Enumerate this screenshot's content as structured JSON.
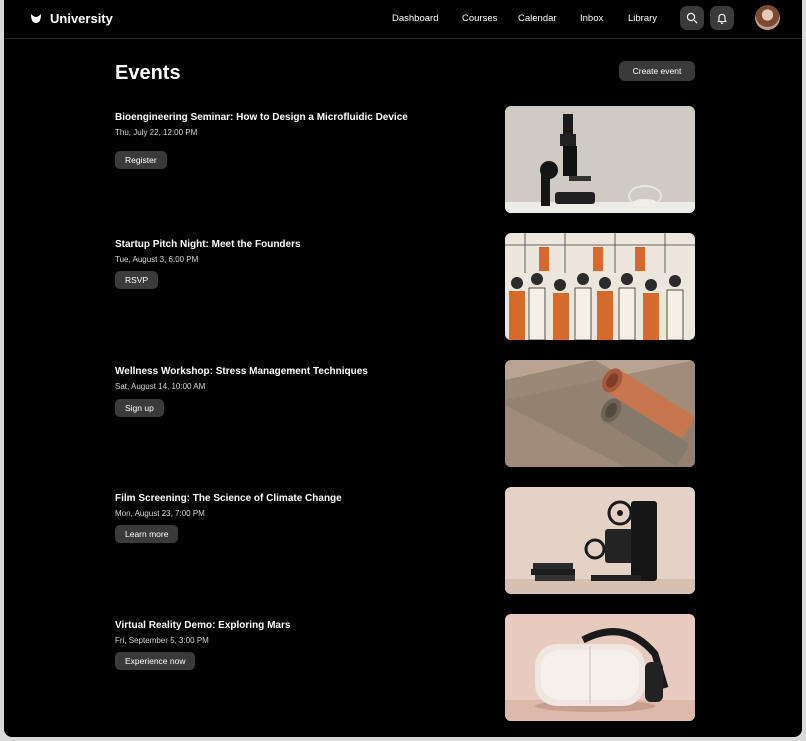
{
  "app": {
    "brand": "University"
  },
  "nav": [
    "Dashboard",
    "Courses",
    "Calendar",
    "Inbox",
    "Library"
  ],
  "page": {
    "title": "Events",
    "create_label": "Create event"
  },
  "events": [
    {
      "title": "Bioengineering Seminar: How to Design a Microfluidic Device",
      "date": "Thu, July 22, 12:00 PM",
      "action": "Register",
      "image": "microscope"
    },
    {
      "title": "Startup Pitch Night: Meet the Founders",
      "date": "Tue, August 3, 6:00 PM",
      "action": "RSVP",
      "image": "crowd-illustration"
    },
    {
      "title": "Wellness Workshop: Stress Management Techniques",
      "date": "Sat, August 14, 10:00 AM",
      "action": "Sign up",
      "image": "yoga-mats"
    },
    {
      "title": "Film Screening: The Science of Climate Change",
      "date": "Mon, August 23, 7:00 PM",
      "action": "Learn more",
      "image": "film-projector"
    },
    {
      "title": "Virtual Reality Demo: Exploring Mars",
      "date": "Fri, September 5, 3:00 PM",
      "action": "Experience now",
      "image": "vr-headset"
    }
  ],
  "colors": {
    "background": "#000000",
    "button": "#3a3a3a",
    "text": "#ffffff",
    "accent": "#d6692c"
  },
  "icons": [
    "logo-icon",
    "search-icon",
    "bell-icon"
  ]
}
